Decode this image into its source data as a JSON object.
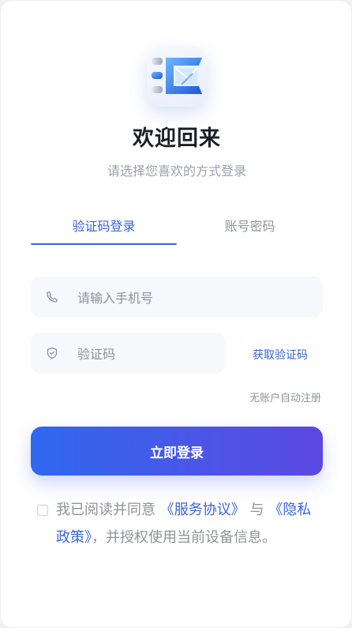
{
  "header": {
    "title": "欢迎回来",
    "subtitle": "请选择您喜欢的方式登录"
  },
  "tabs": [
    {
      "label": "验证码登录",
      "active": true
    },
    {
      "label": "账号密码",
      "active": false
    }
  ],
  "form": {
    "phone_placeholder": "请输入手机号",
    "phone_value": "",
    "code_placeholder": "验证码",
    "code_value": "",
    "get_code_label": "获取验证码",
    "auto_register_note": "无账户自动注册",
    "submit_label": "立即登录"
  },
  "agreement": {
    "checked": false,
    "prefix": "我已阅读并同意",
    "service_link": "《服务协议》",
    "conjunction": "与",
    "privacy_link": "《隐私政策》",
    "suffix": "，并授权使用当前设备信息。"
  },
  "colors": {
    "accent": "#3a64d8",
    "button_gradient_start": "#2f68f0",
    "button_gradient_end": "#5a48e0",
    "muted_text": "#8f939a",
    "field_background": "#f6f8fb"
  },
  "icons": {
    "logo": "app-logo",
    "phone": "phone-icon",
    "code": "shield-check-icon"
  }
}
